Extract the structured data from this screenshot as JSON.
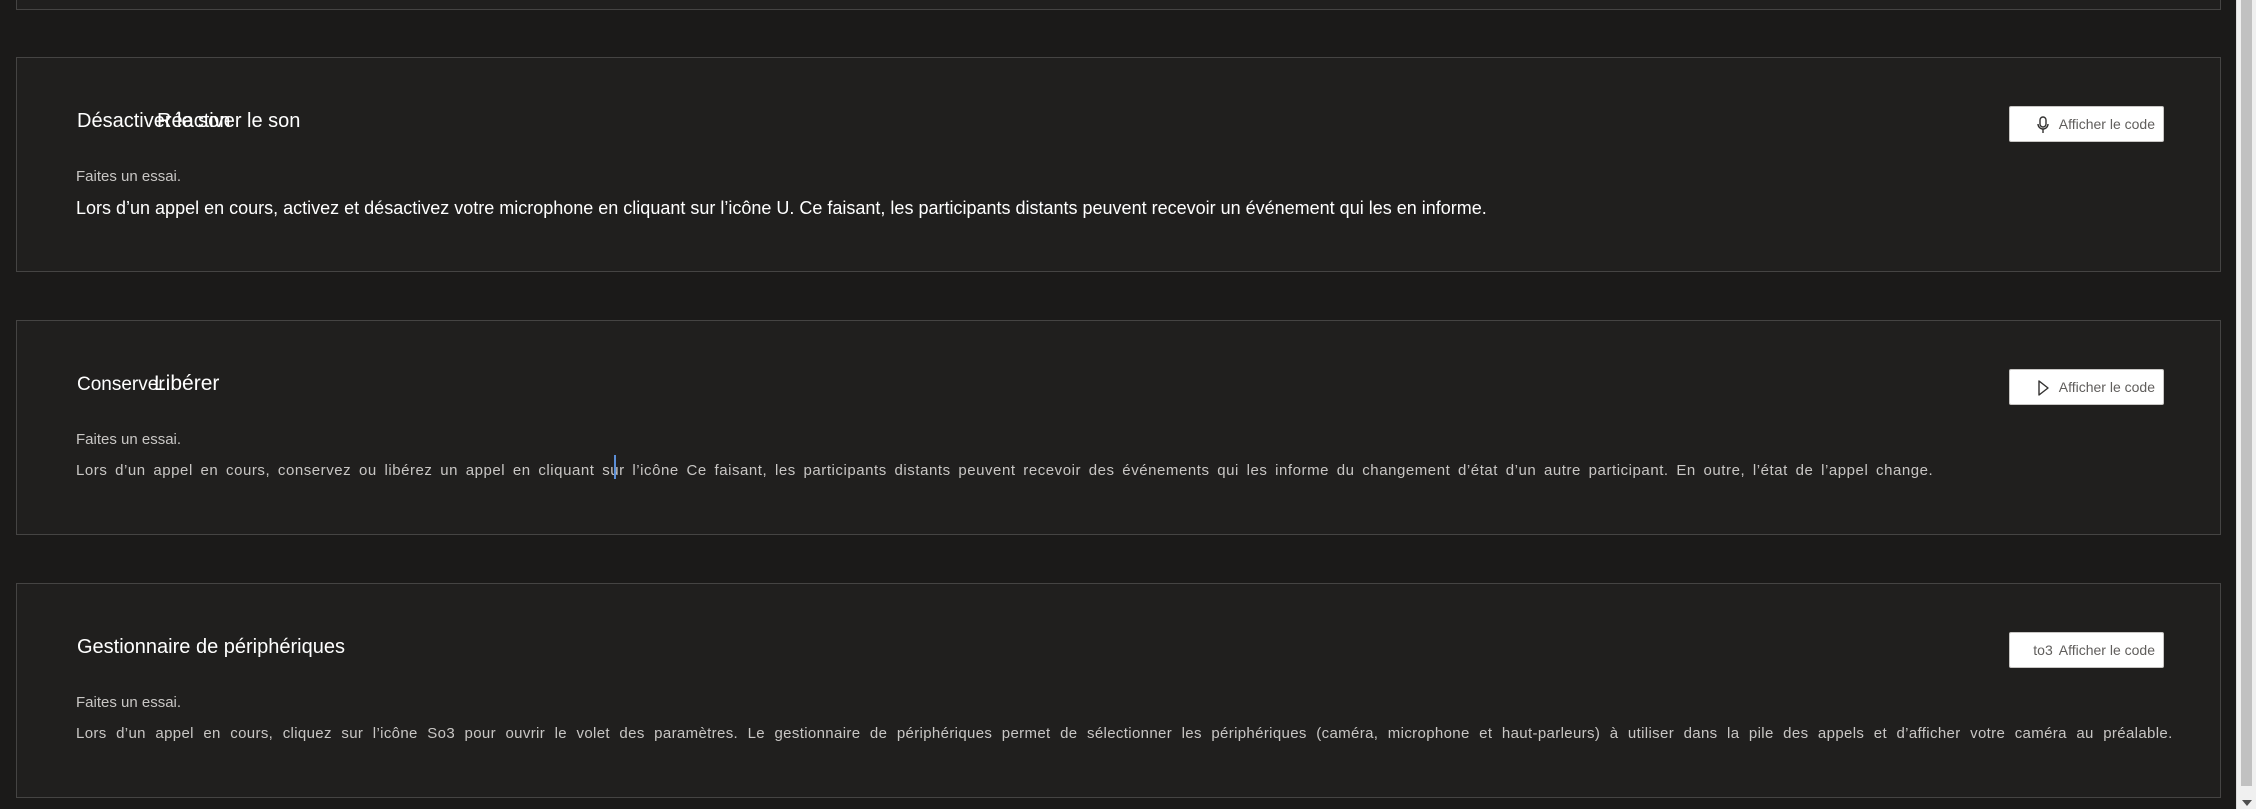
{
  "sections": [
    {
      "title_a": "Désactiver le son",
      "title_b": "Réactiver le son",
      "subtitle": "Faites un essai.",
      "description": "Lors d’un appel en cours, activez et désactivez votre microphone en cliquant sur l’icône U. Ce faisant, les participants distants peuvent recevoir un événement qui les en informe.",
      "button_label": "Afficher le code",
      "button_icon": "microphone-icon"
    },
    {
      "title_a": "Conserver",
      "title_b": "Libérer",
      "subtitle": "Faites un essai.",
      "description": "Lors d’un appel en cours, conservez ou libérez un appel en cliquant sur l’icône Ce faisant, les participants distants peuvent recevoir des événements qui les informe du changement d’état d’un autre participant. En outre, l’état de l’appel change.",
      "button_label": "Afficher le code",
      "button_icon": "play-icon"
    },
    {
      "title": "Gestionnaire de périphériques",
      "subtitle": "Faites un essai.",
      "description": "Lors d’un appel en cours, cliquez sur l’icône So3 pour ouvrir le volet des paramètres. Le gestionnaire de périphériques permet de sélectionner les périphériques (caméra, microphone et haut-parleurs) à utiliser dans la pile des appels et d’afficher votre caméra au préalable.",
      "button_prefix": "to3",
      "button_label": "Afficher le code"
    }
  ]
}
